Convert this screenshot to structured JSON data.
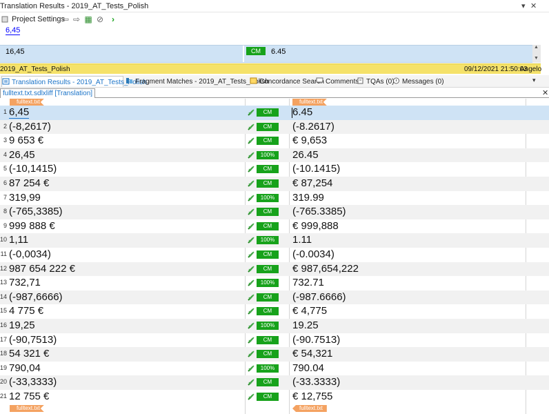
{
  "translation_results": {
    "title": "Translation Results - 2019_AT_Tests_Polish",
    "pin_icon": "pin-icon",
    "close_icon": "close-icon",
    "toolbar": {
      "project_settings_label": "Project Settings"
    },
    "source_preview": "6,45",
    "match": {
      "source": "16,45",
      "badge": "CM",
      "target": "6.45"
    },
    "status": {
      "project": "2019_AT_Tests_Polish",
      "datetime": "09/12/2021 21:50:03",
      "user": "Angelo"
    }
  },
  "tabs": [
    {
      "label": "Translation Results - 2019_AT_Tests_Polish",
      "icon": "translation-results-icon",
      "active": true
    },
    {
      "label": "Fragment Matches - 2019_AT_Tests_Polish",
      "icon": "fragment-matches-icon",
      "active": false
    },
    {
      "label": "Concordance Search",
      "icon": "concordance-icon",
      "active": false
    },
    {
      "label": "Comments",
      "icon": "comments-icon",
      "active": false
    },
    {
      "label": "TQAs (0)",
      "icon": "tqa-icon",
      "active": false
    },
    {
      "label": "Messages (0)",
      "icon": "messages-icon",
      "active": false
    }
  ],
  "document": {
    "tab_label": "fulltext.txt.sdlxliff [Translation]",
    "file_tag": "fulltext.txt",
    "colors": {
      "cm_badge": "#17a21b",
      "file_tag": "#f4a261",
      "selected_row": "#cfe3f5",
      "status_bar": "#f5e26a"
    },
    "segments": [
      {
        "num": "1",
        "source": "6,45",
        "badge": "CM",
        "target": "6.45"
      },
      {
        "num": "2",
        "source": "(-8,2617)",
        "badge": "CM",
        "target": "(-8.2617)"
      },
      {
        "num": "3",
        "source": "9 653 €",
        "badge": "CM",
        "target": "€ 9,653"
      },
      {
        "num": "4",
        "source": "26,45",
        "badge": "100%",
        "target": "26.45"
      },
      {
        "num": "5",
        "source": "(-10,1415)",
        "badge": "CM",
        "target": "(-10.1415)"
      },
      {
        "num": "6",
        "source": "87 254 €",
        "badge": "CM",
        "target": "€ 87,254"
      },
      {
        "num": "7",
        "source": "319,99",
        "badge": "100%",
        "target": "319.99"
      },
      {
        "num": "8",
        "source": "(-765,3385)",
        "badge": "CM",
        "target": "(-765.3385)"
      },
      {
        "num": "9",
        "source": "999 888 €",
        "badge": "CM",
        "target": "€ 999,888"
      },
      {
        "num": "10",
        "source": "1,11",
        "badge": "100%",
        "target": "1.11"
      },
      {
        "num": "11",
        "source": "(-0,0034)",
        "badge": "CM",
        "target": "(-0.0034)"
      },
      {
        "num": "12",
        "source": "987 654 222 €",
        "badge": "CM",
        "target": "€ 987,654,222"
      },
      {
        "num": "13",
        "source": "732,71",
        "badge": "100%",
        "target": "732.71"
      },
      {
        "num": "14",
        "source": "(-987,6666)",
        "badge": "CM",
        "target": "(-987.6666)"
      },
      {
        "num": "15",
        "source": "4 775 €",
        "badge": "CM",
        "target": "€ 4,775"
      },
      {
        "num": "16",
        "source": "19,25",
        "badge": "100%",
        "target": "19.25"
      },
      {
        "num": "17",
        "source": "(-90,7513)",
        "badge": "CM",
        "target": "(-90.7513)"
      },
      {
        "num": "18",
        "source": "54 321 €",
        "badge": "CM",
        "target": "€ 54,321"
      },
      {
        "num": "19",
        "source": "790,04",
        "badge": "100%",
        "target": "790.04"
      },
      {
        "num": "20",
        "source": "(-33,3333)",
        "badge": "CM",
        "target": "(-33.3333)"
      },
      {
        "num": "21",
        "source": "12 755 €",
        "badge": "CM",
        "target": "€ 12,755"
      }
    ]
  }
}
